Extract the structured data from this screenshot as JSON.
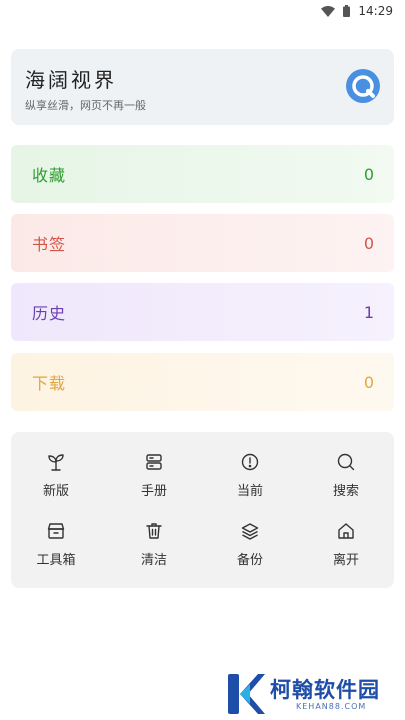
{
  "status_bar": {
    "time": "14:29",
    "icons": [
      "wifi-icon",
      "battery-icon"
    ]
  },
  "header": {
    "title": "海阔视界",
    "subtitle": "纵享丝滑，网页不再一般",
    "logo_icon": "app-logo-icon",
    "accent": "#4a90e2"
  },
  "stats": [
    {
      "label": "收藏",
      "value": "0",
      "color": "#2e9e2e"
    },
    {
      "label": "书签",
      "value": "0",
      "color": "#d45548"
    },
    {
      "label": "历史",
      "value": "1",
      "color": "#6a3fb2"
    },
    {
      "label": "下载",
      "value": "0",
      "color": "#e1a640"
    }
  ],
  "tools": [
    {
      "label": "新版",
      "icon": "sprout-icon"
    },
    {
      "label": "手册",
      "icon": "manual-icon"
    },
    {
      "label": "当前",
      "icon": "info-icon"
    },
    {
      "label": "搜索",
      "icon": "search-icon"
    },
    {
      "label": "工具箱",
      "icon": "toolbox-icon"
    },
    {
      "label": "清洁",
      "icon": "trash-icon"
    },
    {
      "label": "备份",
      "icon": "layers-icon"
    },
    {
      "label": "离开",
      "icon": "home-icon"
    }
  ],
  "watermark": {
    "name": "柯翰软件园",
    "url": "KEHAN88.COM"
  }
}
